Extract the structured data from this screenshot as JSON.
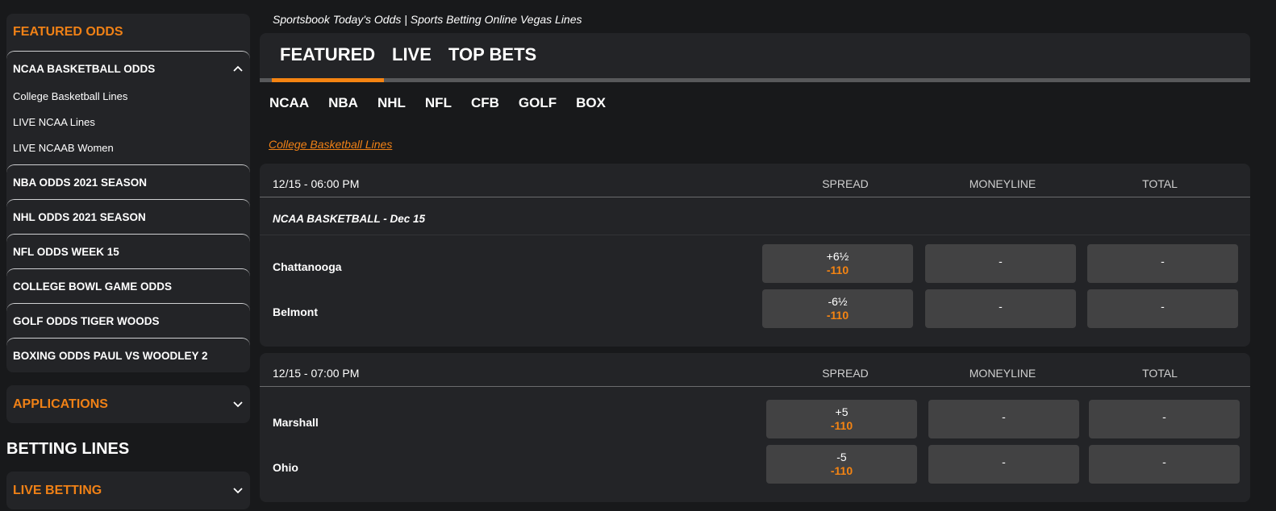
{
  "sidebar": {
    "featured_title": "FEATURED ODDS",
    "accordions": [
      {
        "label": "NCAA BASKETBALL ODDS",
        "expanded": true,
        "sublinks": [
          "College Basketball Lines",
          "LIVE NCAA Lines",
          "LIVE NCAAB Women"
        ]
      },
      {
        "label": "NBA ODDS 2021 SEASON"
      },
      {
        "label": "NHL ODDS 2021 SEASON"
      },
      {
        "label": "NFL ODDS WEEK 15"
      },
      {
        "label": "COLLEGE BOWL GAME ODDS"
      },
      {
        "label": "GOLF ODDS TIGER WOODS"
      },
      {
        "label": "BOXING ODDS PAUL VS WOODLEY 2"
      }
    ],
    "applications_title": "APPLICATIONS",
    "betting_lines_heading": "BETTING LINES",
    "live_betting_title": "LIVE BETTING"
  },
  "main": {
    "page_title": "Sportsbook Today's Odds | Sports Betting Online Vegas Lines",
    "tabs": [
      {
        "label": "FEATURED",
        "active": true
      },
      {
        "label": "LIVE"
      },
      {
        "label": "TOP BETS"
      }
    ],
    "sports": [
      "NCAA",
      "NBA",
      "NHL",
      "NFL",
      "CFB",
      "GOLF",
      "BOX"
    ],
    "category_link": "College Basketball Lines",
    "columns": {
      "spread": "SPREAD",
      "moneyline": "MONEYLINE",
      "total": "TOTAL"
    },
    "games": [
      {
        "time": "12/15 - 06:00 PM",
        "league": "NCAA BASKETBALL - Dec 15",
        "teams": [
          {
            "name": "Chattanooga",
            "spread_line": "+6½",
            "spread_price": "-110",
            "moneyline": "-",
            "total": "-"
          },
          {
            "name": "Belmont",
            "spread_line": "-6½",
            "spread_price": "-110",
            "moneyline": "-",
            "total": "-"
          }
        ]
      },
      {
        "time": "12/15 - 07:00 PM",
        "teams": [
          {
            "name": "Marshall",
            "spread_line": "+5",
            "spread_price": "-110",
            "moneyline": "-",
            "total": "-"
          },
          {
            "name": "Ohio",
            "spread_line": "-5",
            "spread_price": "-110",
            "moneyline": "-",
            "total": "-"
          }
        ]
      }
    ]
  },
  "colors": {
    "accent": "#f58412",
    "panel": "#232427",
    "background": "#18191b",
    "odds_cell": "#424243"
  }
}
